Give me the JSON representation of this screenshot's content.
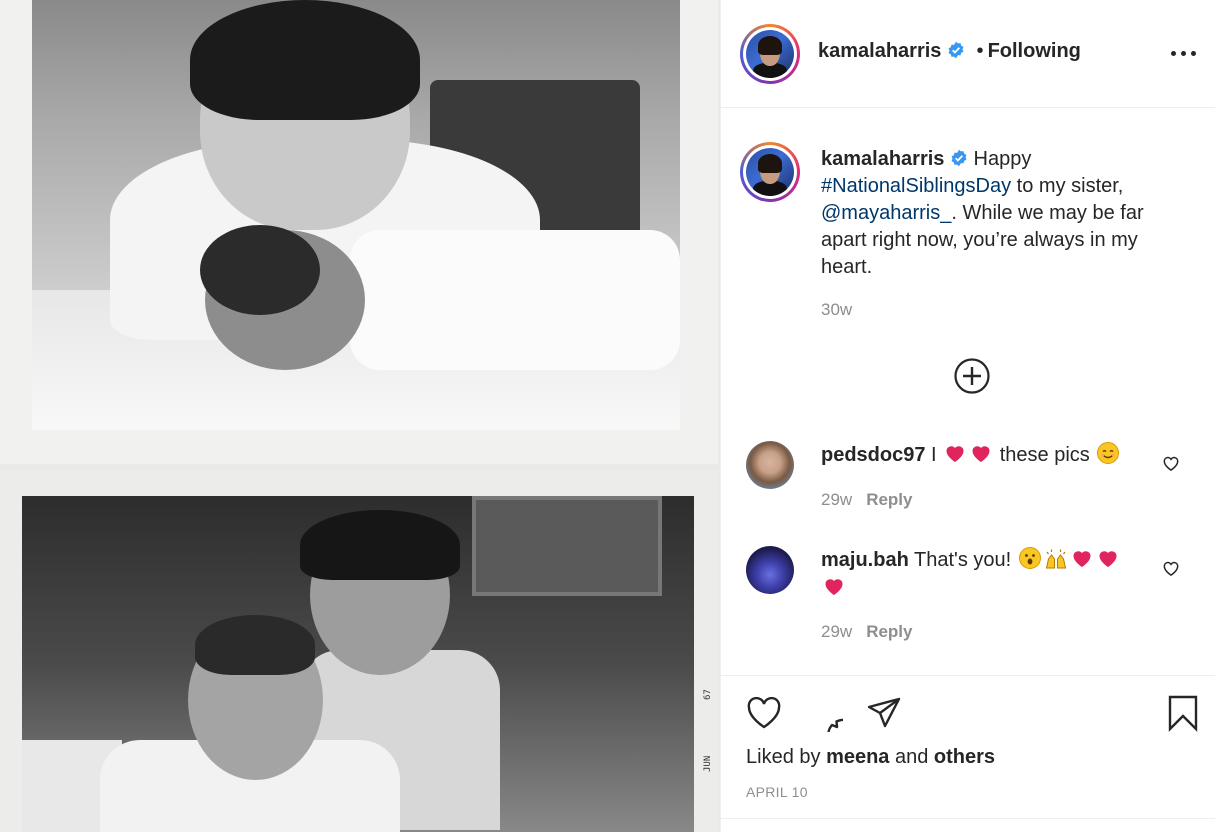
{
  "post": {
    "username": "kamalaharris",
    "dot": "•",
    "follow_status": "Following",
    "caption": {
      "username": "kamalaharris",
      "text_before": " Happy ",
      "hashtag": "#NationalSiblingsDay",
      "text_mid": " to my sister, ",
      "mention": "@mayaharris_",
      "text_after": ". While we may be far apart right now, you’re always in my heart.",
      "time": "30w"
    },
    "comments": [
      {
        "username": "pedsdoc97",
        "text_before": " I ",
        "text_after": " these pics ",
        "time": "29w",
        "reply_label": "Reply"
      },
      {
        "username": "maju.bah",
        "text_before": " That's you! ",
        "time": "29w",
        "reply_label": "Reply"
      }
    ],
    "likes": {
      "prefix": "Liked by ",
      "user": "meena",
      "middle": " and ",
      "others": "others"
    },
    "date": "APRIL 10"
  },
  "photo": {
    "film_label_1": "67",
    "film_label_2": "JUN"
  },
  "icons": {
    "more": "more-options-icon",
    "verified": "verified-badge-icon",
    "load_more": "plus-circle-icon",
    "like": "heart-icon",
    "comment": "comment-icon",
    "share": "paper-plane-icon",
    "save": "bookmark-icon"
  },
  "colors": {
    "verified": "#3897f0",
    "link": "#00376b",
    "heart_emoji": "#e0245e",
    "secondary_text": "#8e8e8e"
  }
}
